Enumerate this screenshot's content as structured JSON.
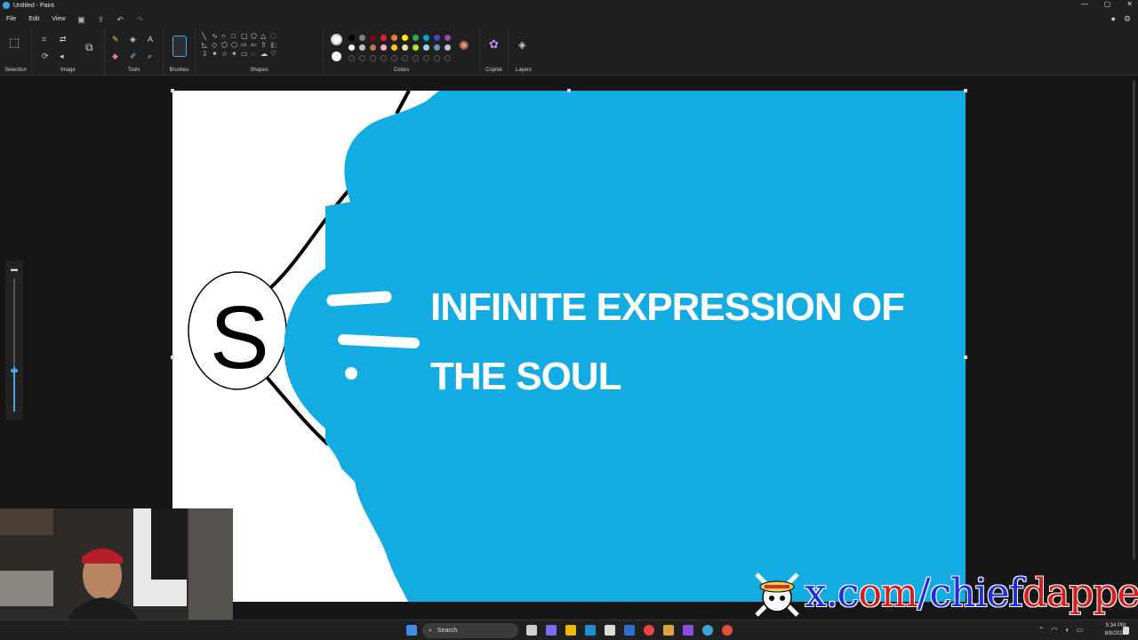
{
  "window": {
    "title": "Untitled - Paint",
    "controls": [
      "—",
      "▢",
      "✕"
    ]
  },
  "menu": {
    "file": "File",
    "edit": "Edit",
    "view": "View"
  },
  "ribbon": {
    "groups": {
      "selection": "Selection",
      "image": "Image",
      "tools": "Tools",
      "brushes": "Brushes",
      "shapes": "Shapes",
      "colors": "Colors",
      "copilot": "Copilot",
      "layers": "Layers"
    },
    "palette_row1": [
      "#000000",
      "#7f7f7f",
      "#880015",
      "#ed1c24",
      "#ff7f27",
      "#fff200",
      "#22b14c",
      "#00a2e8",
      "#3f48cc",
      "#a349a4"
    ],
    "palette_row2": [
      "#ffffff",
      "#c3c3c3",
      "#b97a57",
      "#ffaec9",
      "#ffc90e",
      "#efe4b0",
      "#b5e61d",
      "#99d9ea",
      "#7092be",
      "#c8bfe7"
    ],
    "primary_color": "#ffffff",
    "secondary_color": "#ffffff"
  },
  "canvas": {
    "text_line1": "INFINITE EXPRESSION OF",
    "text_line2": "THE SOUL",
    "circle_letter": "S",
    "fill_color": "#12abe2"
  },
  "taskbar": {
    "search_label": "Search",
    "time": "5:34 PM",
    "date": "8/8/2025"
  },
  "watermark": {
    "part1": "x.c",
    "part2": "om",
    "part3": "/chief",
    "part4": "dapper"
  }
}
